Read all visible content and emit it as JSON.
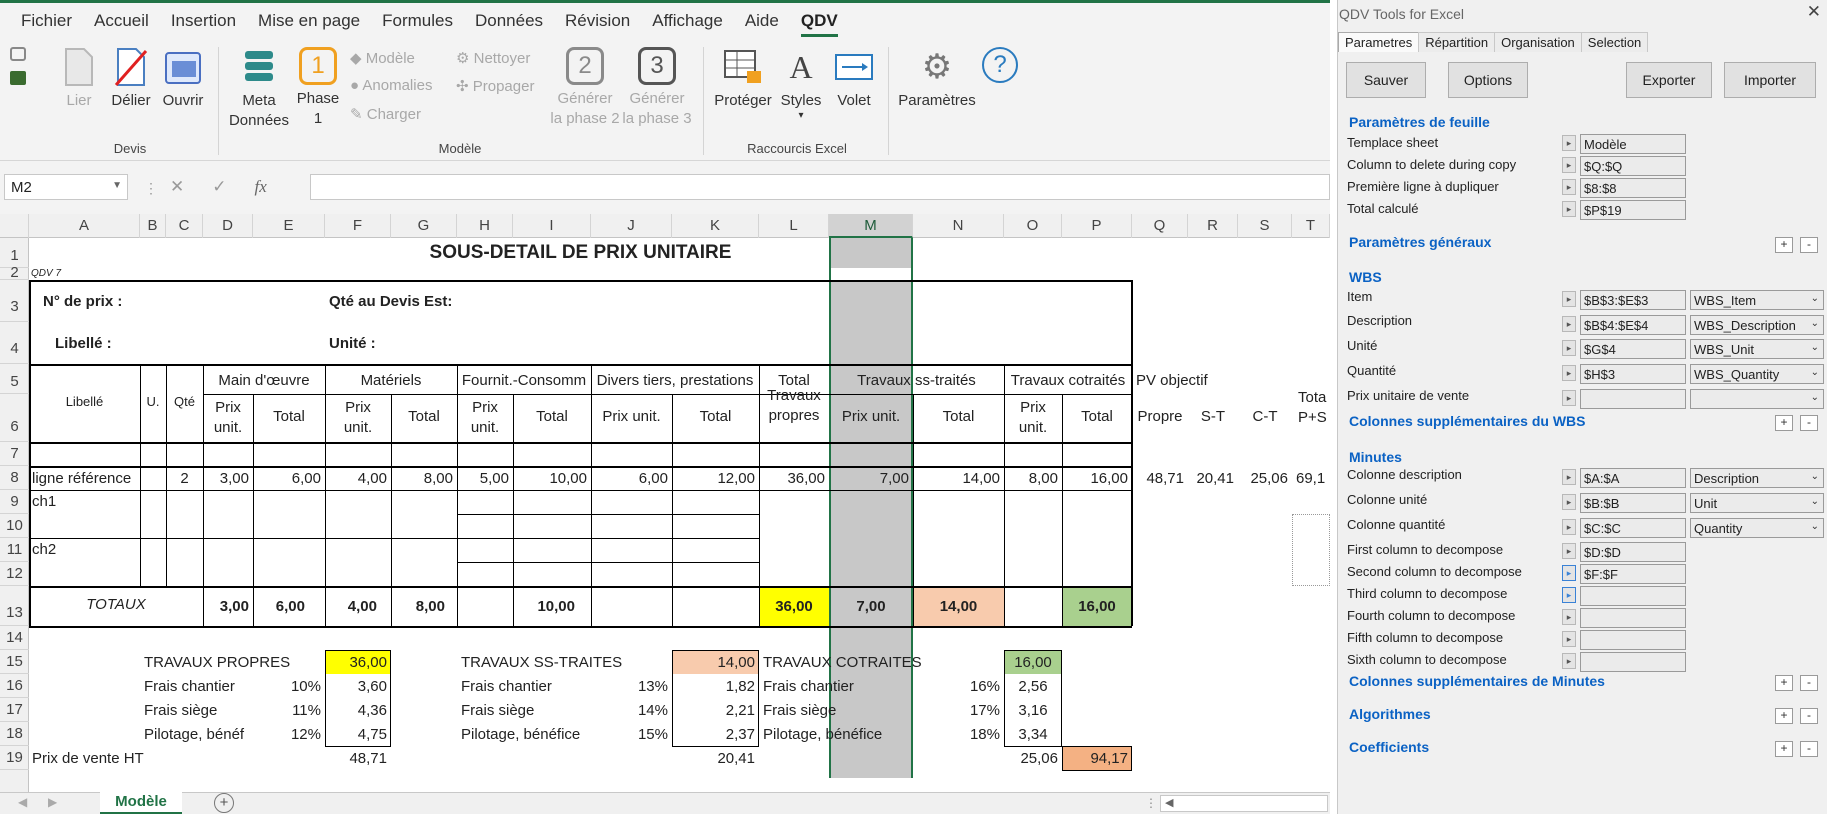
{
  "ribbon_tabs": [
    "Fichier",
    "Accueil",
    "Insertion",
    "Mise en page",
    "Formules",
    "Données",
    "Révision",
    "Affichage",
    "Aide",
    "QDV"
  ],
  "ribbon": {
    "devis": {
      "group": "Devis",
      "lier": "Lier",
      "delier": "Délier",
      "ouvrir": "Ouvrir"
    },
    "modele": {
      "group": "Modèle",
      "meta_1": "Meta",
      "meta_2": "Données",
      "phase_1": "Phase",
      "phase_2": "1",
      "phase_num": "1",
      "modele": "Modèle",
      "anomalies": "Anomalies",
      "charger": "Charger",
      "nettoyer": "Nettoyer",
      "propager": "Propager",
      "gen2_1": "Générer",
      "gen2_2": "la phase 2",
      "gen2_num": "2",
      "gen3_1": "Générer",
      "gen3_2": "la phase 3",
      "gen3_num": "3"
    },
    "raccourcis": {
      "group": "Raccourcis Excel",
      "proteger": "Protéger",
      "styles": "Styles",
      "volet": "Volet"
    },
    "parametres": "Paramètres"
  },
  "formula_bar": {
    "namebox": "M2",
    "cancel": "✕",
    "confirm": "✓",
    "fx": "fx",
    "value": ""
  },
  "columns": [
    "A",
    "B",
    "C",
    "D",
    "E",
    "F",
    "G",
    "H",
    "I",
    "J",
    "K",
    "L",
    "M",
    "N",
    "O",
    "P",
    "Q",
    "R",
    "S",
    "T"
  ],
  "rows": [
    "1",
    "2",
    "3",
    "4",
    "5",
    "6",
    "7",
    "8",
    "9",
    "10",
    "11",
    "12",
    "13",
    "14",
    "15",
    "16",
    "17",
    "18",
    "19"
  ],
  "sheet": {
    "title": "SOUS-DETAIL DE PRIX UNITAIRE",
    "qdv": "QDV 7",
    "no_prix": "N° de prix :",
    "qte_devis": "Qté au Devis Est:",
    "libelle_lbl": "Libellé :",
    "unite_lbl": "Unité :",
    "h_main": "Main d'œuvre",
    "h_mat": "Matériels",
    "h_fourn": "Fournit.-Consomm",
    "h_divers": "Divers tiers, prestations",
    "h_total": "Total",
    "h_travaux_propres_1": "Travaux",
    "h_travaux_propres_2": "propres",
    "h_sstraites": "Travaux ss-traités",
    "h_cotraites": "Travaux cotraités",
    "h_pv": "PV objectif",
    "h_libelle": "Libellé",
    "h_u": "U.",
    "h_qte": "Qté",
    "h_prix_1": "Prix",
    "h_unit": "unit.",
    "h_prixunit": "Prix unit.",
    "h_tot": "Total",
    "h_propre": "Propre",
    "h_st": "S-T",
    "h_ct": "C-T",
    "h_totap_1": "Tota",
    "h_totap_2": "P+S",
    "r8": {
      "lib": "ligne référence",
      "qte": "2",
      "d": "3,00",
      "e": "6,00",
      "f": "4,00",
      "g": "8,00",
      "h": "5,00",
      "i": "10,00",
      "j": "6,00",
      "k": "12,00",
      "l": "36,00",
      "m": "7,00",
      "n": "14,00",
      "o": "8,00",
      "p": "16,00",
      "q": "48,71",
      "r": "20,41",
      "s": "25,06",
      "t": "69,1"
    },
    "ch1": "ch1",
    "ch2": "ch2",
    "tot": {
      "lbl": "TOTAUX",
      "d": "3,00",
      "e": "6,00",
      "f": "4,00",
      "g": "8,00",
      "i": "10,00",
      "l": "36,00",
      "m": "7,00",
      "n": "14,00",
      "p": "16,00"
    },
    "s1": {
      "t": "TRAVAUX PROPRES",
      "v": "36,00",
      "r16": "Frais chantier",
      "p16": "10%",
      "v16": "3,60",
      "r17": "Frais siège",
      "p17": "11%",
      "v17": "4,36",
      "r18": "Pilotage, bénéf",
      "p18": "12%",
      "v18": "4,75"
    },
    "s2": {
      "t": "TRAVAUX SS-TRAITES",
      "v": "14,00",
      "r16": "Frais chantier",
      "p16": "13%",
      "v16": "1,82",
      "r17": "Frais siège",
      "p17": "14%",
      "v17": "2,21",
      "r18": "Pilotage, bénéfice",
      "p18": "15%",
      "v18": "2,37"
    },
    "s3": {
      "t": "TRAVAUX COTRAITES",
      "v": "16,00",
      "r16": "Frais chantier",
      "p16": "16%",
      "v16": "2,56",
      "r17": "Frais siège",
      "p17": "17%",
      "v17": "3,16",
      "r18": "Pilotage, bénéfice",
      "p18": "18%",
      "v18": "3,34"
    },
    "pv": {
      "lbl": "Prix de vente HT",
      "f": "48,71",
      "k": "20,41",
      "o": "25,06",
      "p": "94,17"
    }
  },
  "sheet_tab": "Modèle",
  "panel": {
    "title": "QDV Tools for Excel",
    "close": "✕",
    "tabs": [
      "Parametres",
      "Répartition",
      "Organisation",
      "Selection"
    ],
    "btn_sauver": "Sauver",
    "btn_options": "Options",
    "btn_exporter": "Exporter",
    "btn_importer": "Importer",
    "sec_feuille": "Paramètres de feuille",
    "feuille": [
      {
        "label": "Templace sheet",
        "value": "Modèle"
      },
      {
        "label": "Column to delete during copy",
        "value": "$Q:$Q"
      },
      {
        "label": "Première ligne à dupliquer",
        "value": "$8:$8"
      },
      {
        "label": "Total calculé",
        "value": "$P$19"
      }
    ],
    "sec_generaux": "Paramètres généraux",
    "sec_wbs": "WBS",
    "wbs": [
      {
        "label": "Item",
        "value": "$B$3:$E$3",
        "sel": "WBS_Item"
      },
      {
        "label": "Description",
        "value": "$B$4:$E$4",
        "sel": "WBS_Description"
      },
      {
        "label": "Unité",
        "value": "$G$4",
        "sel": "WBS_Unit"
      },
      {
        "label": "Quantité",
        "value": "$H$3",
        "sel": "WBS_Quantity"
      },
      {
        "label": "Prix unitaire de vente",
        "value": "",
        "sel": ""
      }
    ],
    "sec_colwbs": "Colonnes supplémentaires du WBS",
    "sec_minutes": "Minutes",
    "minutes": [
      {
        "label": "Colonne description",
        "value": "$A:$A",
        "sel": "Description"
      },
      {
        "label": "Colonne unité",
        "value": "$B:$B",
        "sel": "Unit"
      },
      {
        "label": "Colonne quantité",
        "value": "$C:$C",
        "sel": "Quantity"
      }
    ],
    "decomp": [
      {
        "label": "First column to decompose",
        "value": "$D:$D"
      },
      {
        "label": "Second column to decompose",
        "value": "$F:$F"
      },
      {
        "label": "Third column to decompose",
        "value": ""
      },
      {
        "label": "Fourth column to decompose",
        "value": ""
      },
      {
        "label": "Fifth column to decompose",
        "value": ""
      },
      {
        "label": "Sixth column to decompose",
        "value": ""
      }
    ],
    "sec_colmin": "Colonnes supplémentaires de Minutes",
    "sec_algo": "Algorithmes",
    "sec_coef": "Coefficients",
    "plus": "+",
    "minus": "-"
  },
  "colors": {
    "excel_green": "#217346",
    "yellow": "#ffff00",
    "salmon": "#f8cbad",
    "green": "#a9d08e",
    "orange": "#f4b183",
    "blue_section": "#0b62c4"
  }
}
